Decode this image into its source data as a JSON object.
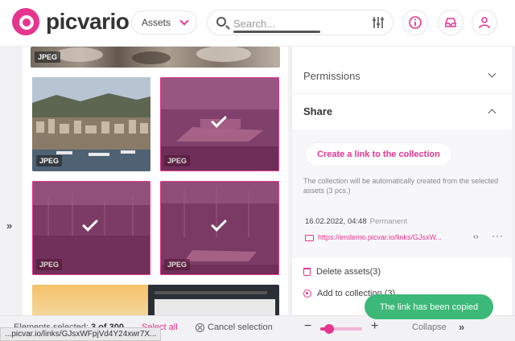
{
  "header": {
    "logo_text": "picvario",
    "assets_label": "Assets",
    "search_placeholder": "Search..."
  },
  "grid": {
    "tiles": [
      {
        "badge": "JPEG",
        "selected": false
      },
      {
        "badge": "JPEG",
        "selected": false
      },
      {
        "badge": "JPEG",
        "selected": true
      },
      {
        "badge": "JPEG",
        "selected": true
      },
      {
        "badge": "JPEG",
        "selected": true
      }
    ]
  },
  "panel": {
    "permissions_label": "Permissions",
    "share_label": "Share",
    "create_link_label": "Create a link to the collection",
    "share_note": "The collection will be automatically created from the selected assets (3 pcs.)",
    "link_date": "16.02.2022, 04:48",
    "link_permanence": "Permanent",
    "link_url": "https://endemo.picvar.io/links/GJsxW...",
    "delete_label": "Delete assets(3)",
    "add_label": "Add to collection (3)"
  },
  "bottom": {
    "selected_prefix": "Elements selected:",
    "selected_value": "3 of 300",
    "select_all": "Select all",
    "cancel_selection": "Cancel selection",
    "zoom_level": 0.22,
    "collapse": "Collapse"
  },
  "status_url": "...picvar.io/links/GJsxWFpjVd4Y24xwr7X...",
  "toast": "The link has been copied",
  "colors": {
    "accent": "#e5358f",
    "success": "#3cb878"
  }
}
